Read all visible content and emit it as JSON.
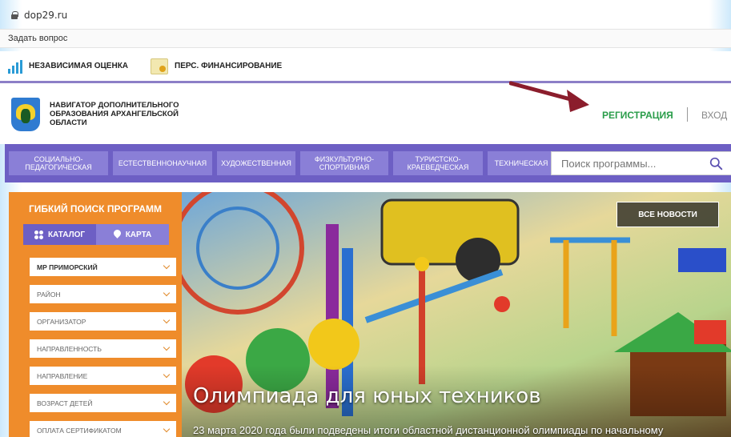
{
  "browser": {
    "url": "dop29.ru"
  },
  "top_links": {
    "ask": "Задать вопрос"
  },
  "topbar": {
    "items": [
      {
        "label": "НЕЗАВИСИМАЯ ОЦЕНКА",
        "icon": "chart-icon"
      },
      {
        "label": "ПЕРС. ФИНАНСИРОВАНИЕ",
        "icon": "money-icon"
      }
    ]
  },
  "header": {
    "org_name": "НАВИГАТОР ДОПОЛНИТЕЛЬНОГО ОБРАЗОВАНИЯ АРХАНГЕЛЬСКОЙ ОБЛАСТИ",
    "register": "РЕГИСТРАЦИЯ",
    "login": "ВХОД"
  },
  "nav": {
    "categories": [
      "СОЦИАЛЬНО-ПЕДАГОГИЧЕСКАЯ",
      "ЕСТЕСТВЕННОНАУЧНАЯ",
      "ХУДОЖЕСТВЕННАЯ",
      "ФИЗКУЛЬТУРНО-СПОРТИВНАЯ",
      "ТУРИСТСКО-КРАЕВЕДЧЕСКАЯ",
      "ТЕХНИЧЕСКАЯ"
    ],
    "search_placeholder": "Поиск программы..."
  },
  "sidebar": {
    "title": "ГИБКИЙ ПОИСК ПРОГРАММ",
    "catalog": "КАТАЛОГ",
    "map": "КАРТА",
    "filters": [
      "МР ПРИМОРСКИЙ",
      "РАЙОН",
      "ОРГАНИЗАТОР",
      "НАПРАВЛЕННОСТЬ",
      "НАПРАВЛЕНИЕ",
      "ВОЗРАСТ ДЕТЕЙ",
      "ОПЛАТА СЕРТИФИКАТОМ"
    ]
  },
  "banner": {
    "all_news": "ВСЕ НОВОСТИ",
    "title": "Олимпиада для юных техников",
    "text": "23 марта 2020 года были подведены итоги областной дистанционной олимпиады по начальному"
  },
  "colors": {
    "nav_bg": "#6d5fc4",
    "nav_btn": "#8a7fd7",
    "sidebar_bg": "#ef8c2b",
    "register": "#2a9d4a",
    "arrow": "#8b1d2c"
  }
}
